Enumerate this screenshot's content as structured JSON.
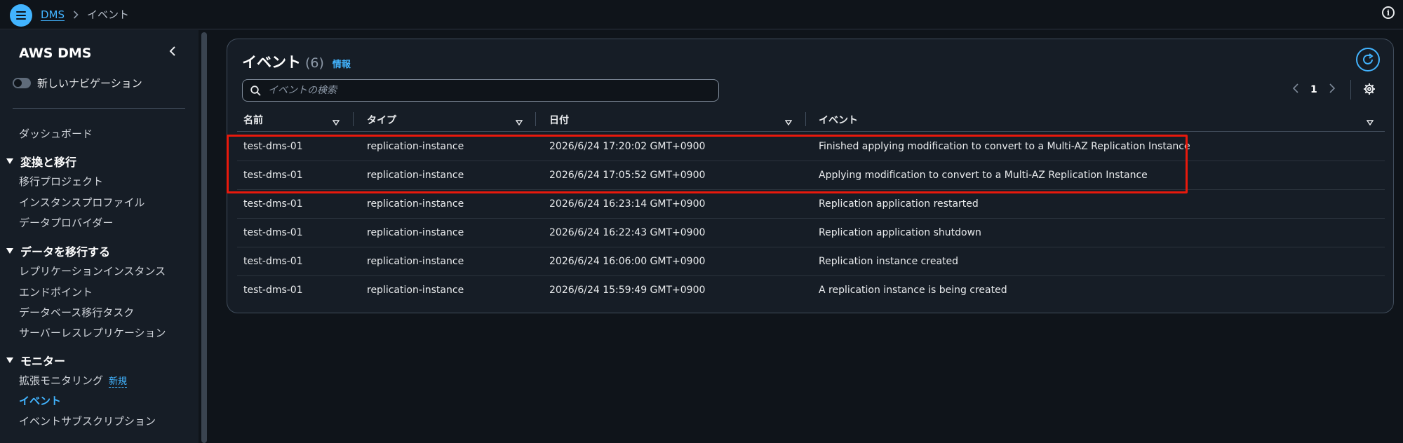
{
  "breadcrumb": {
    "root": "DMS",
    "current": "イベント"
  },
  "sidebar": {
    "title": "AWS DMS",
    "toggle_label": "新しいナビゲーション",
    "dashboard": "ダッシュボード",
    "sections": [
      {
        "label": "変換と移行",
        "items": [
          "移行プロジェクト",
          "インスタンスプロファイル",
          "データプロバイダー"
        ]
      },
      {
        "label": "データを移行する",
        "items": [
          "レプリケーションインスタンス",
          "エンドポイント",
          "データベース移行タスク",
          "サーバーレスレプリケーション"
        ]
      },
      {
        "label": "モニター",
        "items": [
          "拡張モニタリング",
          "イベント",
          "イベントサブスクリプション"
        ]
      }
    ],
    "new_badge": "新規",
    "active_item": "イベント"
  },
  "panel": {
    "title": "イベント",
    "count": "(6)",
    "info": "情報",
    "search_placeholder": "イベントの検索",
    "page": "1"
  },
  "table": {
    "columns": [
      "名前",
      "タイプ",
      "日付",
      "イベント"
    ],
    "rows": [
      [
        "test-dms-01",
        "replication-instance",
        "2026/6/24 17:20:02 GMT+0900",
        "Finished applying modification to convert to a Multi-AZ Replication Instance"
      ],
      [
        "test-dms-01",
        "replication-instance",
        "2026/6/24 17:05:52 GMT+0900",
        "Applying modification to convert to a Multi-AZ Replication Instance"
      ],
      [
        "test-dms-01",
        "replication-instance",
        "2026/6/24 16:23:14 GMT+0900",
        "Replication application restarted"
      ],
      [
        "test-dms-01",
        "replication-instance",
        "2026/6/24 16:22:43 GMT+0900",
        "Replication application shutdown"
      ],
      [
        "test-dms-01",
        "replication-instance",
        "2026/6/24 16:06:00 GMT+0900",
        "Replication instance created"
      ],
      [
        "test-dms-01",
        "replication-instance",
        "2026/6/24 15:59:49 GMT+0900",
        "A replication instance is being created"
      ]
    ]
  },
  "colors": {
    "accent": "#42b4ff",
    "highlight": "#e8190c",
    "background": "#0f141a",
    "panel": "#161d26"
  },
  "icons": [
    "menu-icon",
    "chevron-right-icon",
    "info-icon",
    "chevron-left-icon",
    "caret-down-icon",
    "refresh-icon",
    "search-icon",
    "settings-icon",
    "sort-icon"
  ]
}
